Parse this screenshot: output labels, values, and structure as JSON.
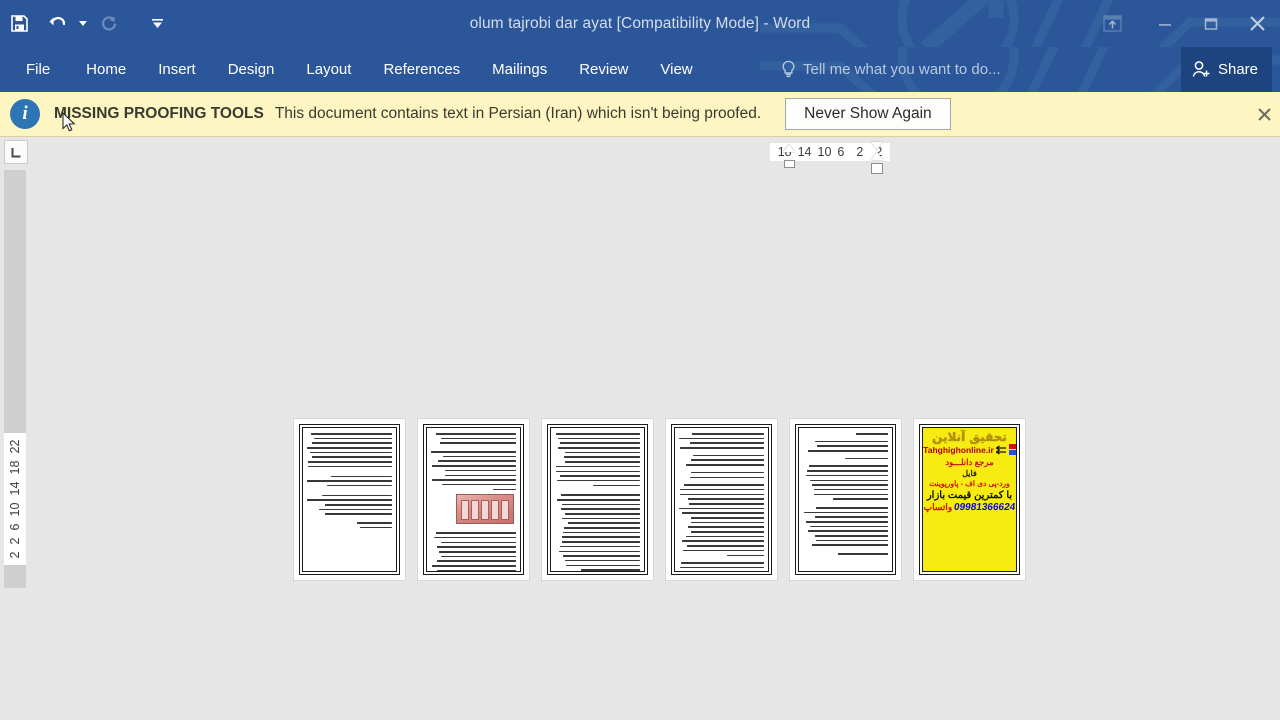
{
  "titlebar": {
    "document_title": "olum tajrobi dar ayat [Compatibility Mode] - Word",
    "quick_access": [
      {
        "name": "save-button",
        "icon": "save-icon",
        "enabled": true
      },
      {
        "name": "undo-button",
        "icon": "undo-icon",
        "enabled": true
      },
      {
        "name": "redo-button",
        "icon": "redo-icon",
        "enabled": false
      },
      {
        "name": "customize-qat-button",
        "icon": "chevron-down-icon",
        "enabled": true
      }
    ],
    "window_controls": [
      {
        "name": "ribbon-display-options",
        "icon": "ribbon-options-icon",
        "label": ""
      },
      {
        "name": "minimize-button",
        "icon": "minimize-icon",
        "label": "—"
      },
      {
        "name": "restore-button",
        "icon": "restore-icon",
        "label": ""
      },
      {
        "name": "close-button",
        "icon": "close-icon",
        "label": "✕"
      }
    ],
    "accent_color": "#2b579a"
  },
  "ribbon": {
    "tabs": [
      {
        "label": "File",
        "active": false
      },
      {
        "label": "Home",
        "active": false
      },
      {
        "label": "Insert",
        "active": false
      },
      {
        "label": "Design",
        "active": false
      },
      {
        "label": "Layout",
        "active": false
      },
      {
        "label": "References",
        "active": false
      },
      {
        "label": "Mailings",
        "active": false
      },
      {
        "label": "Review",
        "active": false
      },
      {
        "label": "View",
        "active": false
      }
    ],
    "tell_me_placeholder": "Tell me what you want to do...",
    "share_label": "Share"
  },
  "infobar": {
    "icon": "info-icon",
    "icon_glyph": "i",
    "title": "MISSING PROOFING TOOLS",
    "message": "This document contains text in Persian (Iran) which isn't being proofed.",
    "button_label": "Never Show Again",
    "close_label": "✕",
    "background_color": "#fdf6c2"
  },
  "rulers": {
    "corner_icon": "tab-stop-left-icon",
    "corner_glyph": "⌞",
    "horizontal_ticks": [
      "18",
      "14",
      "10",
      "6",
      "2",
      "2"
    ],
    "vertical_ticks": [
      "2",
      "2",
      "6",
      "10",
      "14",
      "18",
      "22"
    ]
  },
  "document": {
    "view_mode": "multiple-pages",
    "page_count": 6,
    "pages": [
      {
        "index": 1,
        "name": "page-thumbnail-1",
        "kind": "text",
        "has_image": false
      },
      {
        "index": 2,
        "name": "page-thumbnail-2",
        "kind": "text",
        "has_image": true
      },
      {
        "index": 3,
        "name": "page-thumbnail-3",
        "kind": "text",
        "has_image": false
      },
      {
        "index": 4,
        "name": "page-thumbnail-4",
        "kind": "text",
        "has_image": false
      },
      {
        "index": 5,
        "name": "page-thumbnail-5",
        "kind": "text",
        "has_image": false
      },
      {
        "index": 6,
        "name": "page-thumbnail-6",
        "kind": "advertisement",
        "has_image": false
      }
    ],
    "ad_page": {
      "logo": "تحقیق آنلاین",
      "url": "Tahghighonline.ir",
      "line1": "مرجع دانلـــود",
      "line2": "فایل",
      "line3": "ورد-پی دی اف - پاورپوینت",
      "line4": "با کمترین قیمت بازار",
      "phone": "09981366624",
      "phone_label": "واتساپ",
      "background_color": "#f7ec12"
    }
  }
}
